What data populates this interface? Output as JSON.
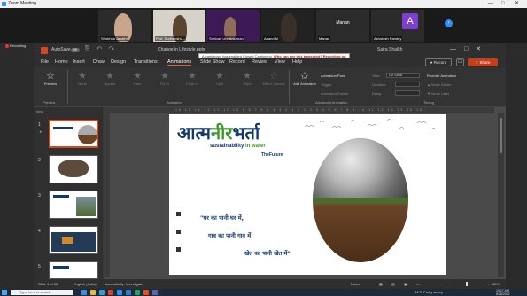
{
  "zoom": {
    "window_title": "Zoom Meeting",
    "window_controls": [
      "—",
      "□",
      "✕"
    ],
    "recording_label": "Recording",
    "participants": [
      {
        "name": "Shobhita Jakathi"
      },
      {
        "name": "Prof. Sudhanshu..."
      },
      {
        "name": "Srinivas Unnikrishnan"
      },
      {
        "name": "Anand M"
      },
      {
        "name": "Manan",
        "tile_text": "Manan"
      },
      {
        "name": "Ashutosh Pandey",
        "avatar_letter": "A"
      }
    ],
    "next_icon": "›"
  },
  "powerpoint": {
    "autosave": "AutoSave",
    "autosave_state": "Off",
    "quick_access": "⎘ ↶ ↷",
    "doc_title": "Change in Lifestyle.pptx",
    "caption_banner": {
      "text": "A participant has enabled Closed Captioning.",
      "link": "Who can see this transcript? Recording on"
    },
    "user_name": "Saira Shaikh",
    "window_controls": [
      "—",
      "□",
      "✕"
    ],
    "menu": [
      "File",
      "Home",
      "Insert",
      "Draw",
      "Design",
      "Transitions",
      "Animations",
      "Slide Show",
      "Record",
      "Review",
      "View",
      "Help"
    ],
    "active_menu": "Animations",
    "record_btn": "● Record",
    "comment_btn": "☐",
    "share_btn": "⇧ Share",
    "ribbon": {
      "preview": "Preview",
      "effects": [
        "None",
        "Appear",
        "Fade",
        "Fly In",
        "Float In",
        "Split",
        "Wipe"
      ],
      "effect_options": "Effect Options",
      "add_animation": "Add Animation",
      "animation_pane": "Animation Pane",
      "trigger": "Trigger",
      "animation_painter": "Animation Painter",
      "start_label": "Start:",
      "start_value": "On Click",
      "duration_label": "Duration:",
      "delay_label": "Delay:",
      "reorder_title": "Reorder Animation",
      "move_earlier": "▲ Move Earlier",
      "move_later": "▼ Move Later",
      "group_labels": {
        "preview": "Preview",
        "animation": "Animation",
        "advanced": "Advanced Animation",
        "timing": "Timing"
      }
    },
    "ruler_text": "16 15 14 13 12 11 10 9 8 7 6 5 4 3 2 1 0 1 2 3 4 5 6 7 8 9 10 11 12 13 14 15 16",
    "thumbnails": {
      "header": "Intro",
      "slides": [
        {
          "number": "1"
        },
        {
          "number": "2"
        },
        {
          "number": "3"
        },
        {
          "number": "4"
        },
        {
          "number": "5"
        }
      ]
    },
    "slide": {
      "title_part1": "आत्म",
      "title_part2": "नीर",
      "title_part3": "भर्ता",
      "tagline_a": "sustainability ",
      "tagline_b": "in water",
      "tagline_c": "TheFuture",
      "line1": "\"घर का पानी घर में,",
      "line2": "गाव का पानी गाव में",
      "line3": "खेत का पानी खेत में\""
    },
    "status": {
      "slide_info": "Slide 1 of 66",
      "language": "English (India)",
      "accessibility": "Accessibility: Investigate",
      "notes": "Notes",
      "zoom": "66%"
    }
  },
  "taskbar": {
    "search_placeholder": "Type here to search",
    "weather": "34°C Partly sunny",
    "time": "10:17 AM",
    "date": "8/28/2022"
  }
}
